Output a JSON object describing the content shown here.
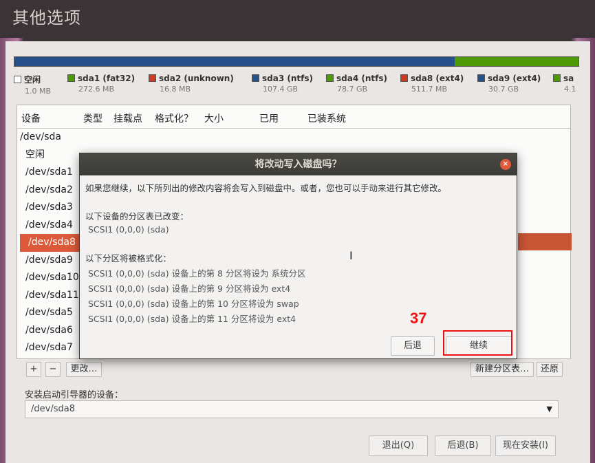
{
  "window": {
    "title": "其他选项"
  },
  "partitions": [
    {
      "name": "空闲",
      "size": "1.0 MB",
      "color": "#ffffff"
    },
    {
      "name": "sda1 (fat32)",
      "size": "272.6 MB",
      "color": "#4e9a06"
    },
    {
      "name": "sda2 (unknown)",
      "size": "16.8 MB",
      "color": "#cc3b22"
    },
    {
      "name": "sda3 (ntfs)",
      "size": "107.4 GB",
      "color": "#27508a"
    },
    {
      "name": "sda4 (ntfs)",
      "size": "78.7 GB",
      "color": "#4e9a06"
    },
    {
      "name": "sda8 (ext4)",
      "size": "511.7 MB",
      "color": "#cc3b22"
    },
    {
      "name": "sda9 (ext4)",
      "size": "30.7 GB",
      "color": "#27508a"
    },
    {
      "name": "sa",
      "size": "4.1",
      "color": "#4e9a06"
    }
  ],
  "table": {
    "headers": {
      "device": "设备",
      "type": "类型",
      "mount": "挂载点",
      "format": "格式化？",
      "size": "大小",
      "used": "已用",
      "installed": "已装系统"
    },
    "devices": [
      "/dev/sda",
      "空闲",
      "/dev/sda1",
      "/dev/sda2",
      "/dev/sda3",
      "/dev/sda4",
      "/dev/sda8",
      "/dev/sda9",
      "/dev/sda10",
      "/dev/sda11",
      "/dev/sda5",
      "/dev/sda6",
      "/dev/sda7"
    ],
    "selected": "/dev/sda8"
  },
  "controls": {
    "add": "+",
    "remove": "−",
    "change": "更改…",
    "new_table": "新建分区表…",
    "revert": "还原"
  },
  "boot": {
    "label": "安装启动引导器的设备：",
    "value": "/dev/sda8"
  },
  "footer": {
    "quit": "退出(Q)",
    "back": "后退(B)",
    "install": "现在安装(I)"
  },
  "dialog": {
    "title": "将改动写入磁盘吗？",
    "intro": "如果您继续，以下所列出的修改内容将会写入到磁盘中。或者，您也可以手动来进行其它修改。",
    "table_changed_heading": "以下设备的分区表已改变：",
    "table_changed_items": [
      "SCSI1 (0,0,0) (sda)"
    ],
    "format_heading": "以下分区将被格式化：",
    "format_items": [
      "SCSI1 (0,0,0) (sda) 设备上的第 8 分区将设为 系统分区",
      "SCSI1 (0,0,0) (sda) 设备上的第 9 分区将设为 ext4",
      "SCSI1 (0,0,0) (sda) 设备上的第 10 分区将设为 swap",
      "SCSI1 (0,0,0) (sda) 设备上的第 11 分区将设为 ext4"
    ],
    "back_label": "后退",
    "continue_label": "继续",
    "close_glyph": "×"
  },
  "annotation": {
    "number": "37",
    "color": "#ee1111"
  },
  "cursor_glyph": "I"
}
